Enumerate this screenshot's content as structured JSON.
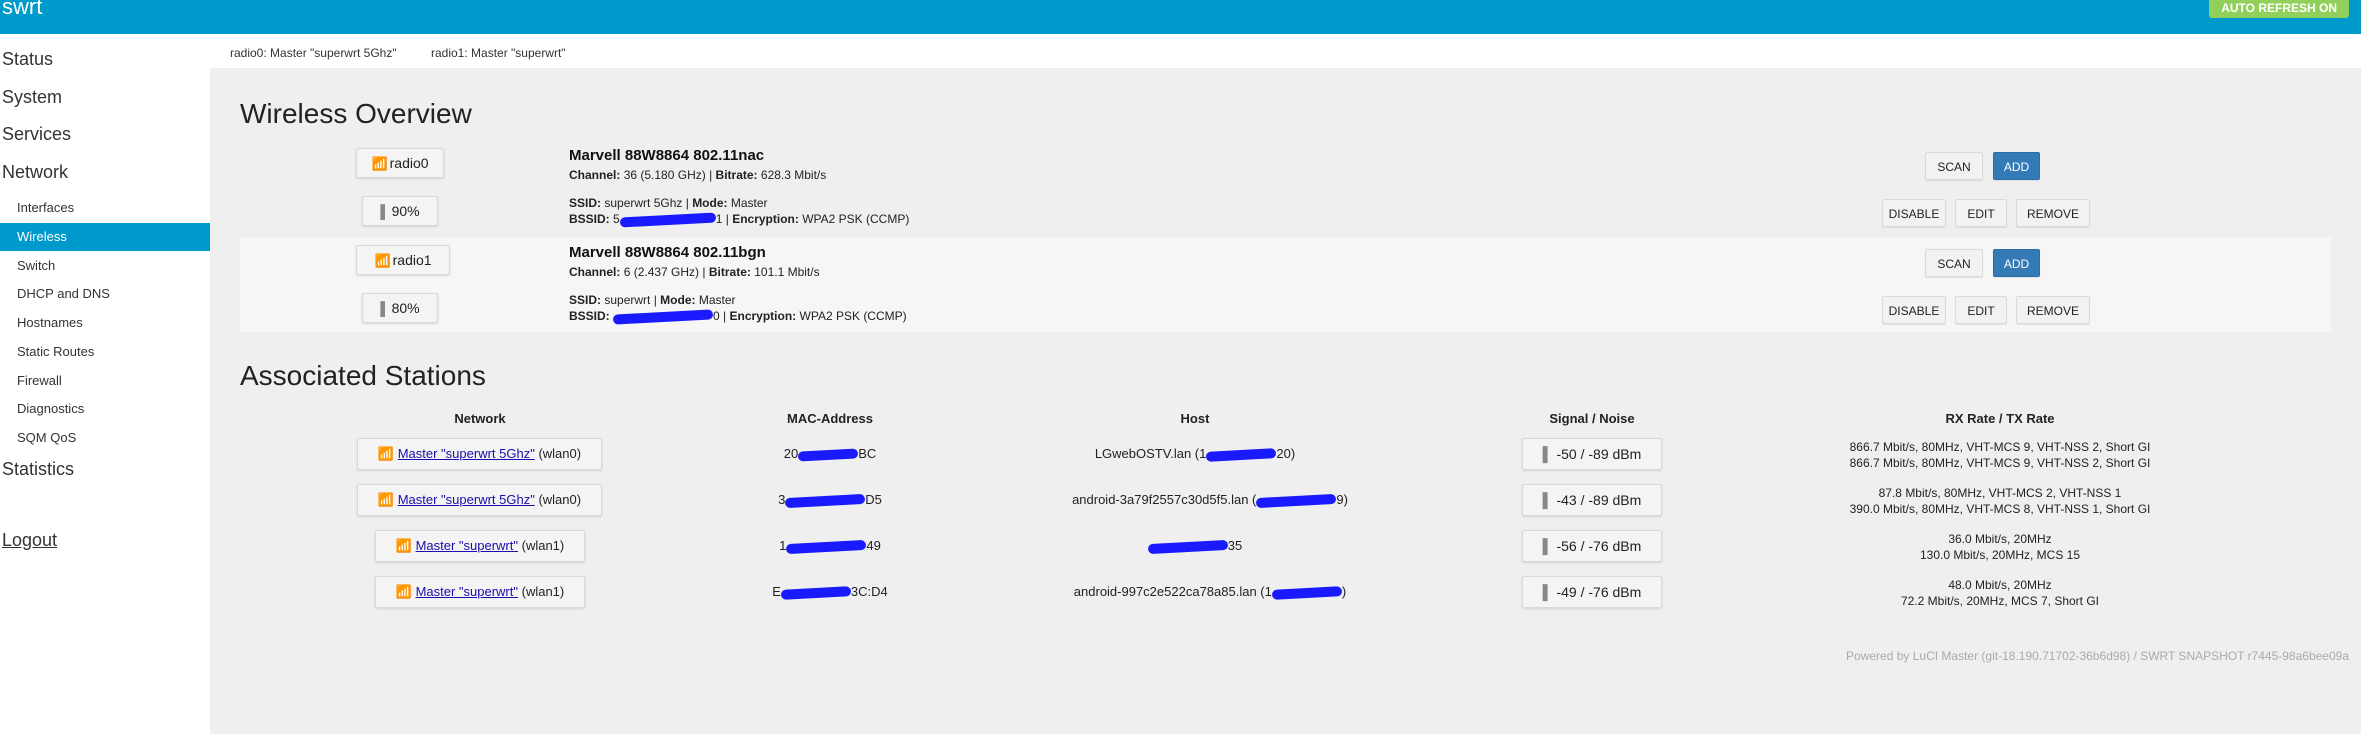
{
  "header": {
    "brand": "swrt",
    "auto_refresh": "AUTO REFRESH ON"
  },
  "sidebar": {
    "status": "Status",
    "system": "System",
    "services": "Services",
    "network": "Network",
    "network_items": [
      "Interfaces",
      "Wireless",
      "Switch",
      "DHCP and DNS",
      "Hostnames",
      "Static Routes",
      "Firewall",
      "Diagnostics",
      "SQM QoS"
    ],
    "statistics": "Statistics",
    "logout": "Logout"
  },
  "subnav": {
    "radio0": "radio0: Master \"superwrt 5Ghz\"",
    "radio1": "radio1: Master \"superwrt\""
  },
  "wireless": {
    "title": "Wireless Overview",
    "devices": [
      {
        "radio": "radio0",
        "signal": "90%",
        "name": "Marvell 88W8864 802.11nac",
        "channel_label": "Channel:",
        "channel": "36 (5.180 GHz)",
        "bitrate_label": "Bitrate:",
        "bitrate": "628.3 Mbit/s",
        "ssid_label": "SSID:",
        "ssid": "superwrt 5Ghz",
        "mode_label": "Mode:",
        "mode": "Master",
        "bssid_label": "BSSID:",
        "bssid_start": "5",
        "bssid_end": "1",
        "enc_label": "Encryption:",
        "encryption": "WPA2 PSK (CCMP)"
      },
      {
        "radio": "radio1",
        "signal": "80%",
        "name": "Marvell 88W8864 802.11bgn",
        "channel_label": "Channel:",
        "channel": "6 (2.437 GHz)",
        "bitrate_label": "Bitrate:",
        "bitrate": "101.1 Mbit/s",
        "ssid_label": "SSID:",
        "ssid": "superwrt",
        "mode_label": "Mode:",
        "mode": "Master",
        "bssid_label": "BSSID:",
        "bssid_start": "",
        "bssid_end": "0",
        "enc_label": "Encryption:",
        "encryption": "WPA2 PSK (CCMP)"
      }
    ],
    "buttons": {
      "scan": "SCAN",
      "add": "ADD",
      "disable": "DISABLE",
      "edit": "EDIT",
      "remove": "REMOVE"
    }
  },
  "stations": {
    "title": "Associated Stations",
    "headers": [
      "Network",
      "MAC-Address",
      "Host",
      "Signal / Noise",
      "RX Rate / TX Rate"
    ],
    "rows": [
      {
        "net_link": "Master \"superwrt 5Ghz\"",
        "iface": "(wlan0)",
        "mac_start": "20",
        "mac_end": "BC",
        "host": "LGwebOSTV.lan (1",
        "host_end": "20)",
        "signal": "-50 / -89 dBm",
        "rx": "866.7 Mbit/s, 80MHz, VHT-MCS 9, VHT-NSS 2, Short GI",
        "tx": "866.7 Mbit/s, 80MHz, VHT-MCS 9, VHT-NSS 2, Short GI"
      },
      {
        "net_link": "Master \"superwrt 5Ghz\"",
        "iface": "(wlan0)",
        "mac_start": "3",
        "mac_end": "D5",
        "host": "android-3a79f2557c30d5f5.lan (",
        "host_end": "9)",
        "signal": "-43 / -89 dBm",
        "rx": "87.8 Mbit/s, 80MHz, VHT-MCS 2, VHT-NSS 1",
        "tx": "390.0 Mbit/s, 80MHz, VHT-MCS 8, VHT-NSS 1, Short GI"
      },
      {
        "net_link": "Master \"superwrt\"",
        "iface": "(wlan1)",
        "mac_start": "1",
        "mac_end": "49",
        "host": "",
        "host_end": "35",
        "signal": "-56 / -76 dBm",
        "rx": "36.0 Mbit/s, 20MHz",
        "tx": "130.0 Mbit/s, 20MHz, MCS 15"
      },
      {
        "net_link": "Master \"superwrt\"",
        "iface": "(wlan1)",
        "mac_start": "E",
        "mac_end": "3C:D4",
        "host": "android-997c2e522ca78a85.lan (1",
        "host_end": ")",
        "signal": "-49 / -76 dBm",
        "rx": "48.0 Mbit/s, 20MHz",
        "tx": "72.2 Mbit/s, 20MHz, MCS 7, Short GI"
      }
    ]
  },
  "footer": "Powered by LuCI Master (git-18.190.71702-36b6d98) / SWRT SNAPSHOT r7445-98a6bee09a",
  "icons": {
    "wifi": "wifi-icon",
    "signal": "signal-bars-icon"
  },
  "colors": {
    "header": "#0099cc",
    "primary_button": "#337ab7",
    "auto_refresh": "#90d05b",
    "redaction": "#1a1aff"
  }
}
